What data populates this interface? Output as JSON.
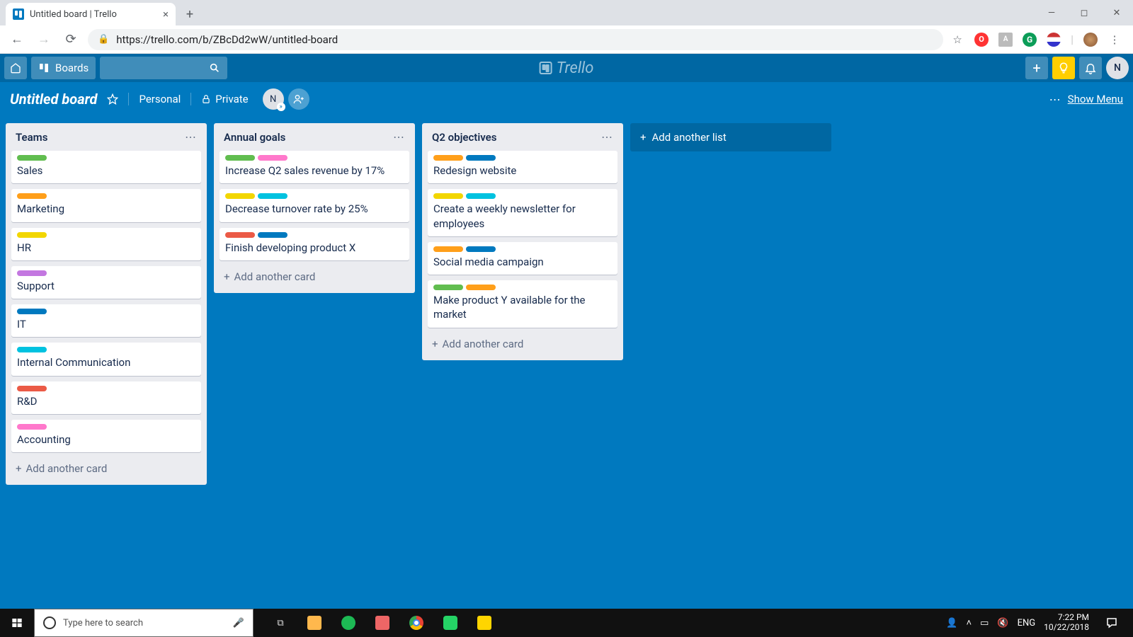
{
  "browser": {
    "tab_title": "Untitled board | Trello",
    "url": "https://trello.com/b/ZBcDd2wW/untitled-board"
  },
  "trello_header": {
    "boards_btn": "Boards",
    "logo_text": "Trello",
    "avatar_initial": "N"
  },
  "board_header": {
    "name": "Untitled board",
    "team": "Personal",
    "visibility": "Private",
    "member_initial": "N",
    "show_menu": "Show Menu"
  },
  "lists": [
    {
      "title": "Teams",
      "cards": [
        {
          "labels": [
            "g"
          ],
          "title": "Sales"
        },
        {
          "labels": [
            "o"
          ],
          "title": "Marketing"
        },
        {
          "labels": [
            "y"
          ],
          "title": "HR"
        },
        {
          "labels": [
            "p"
          ],
          "title": "Support"
        },
        {
          "labels": [
            "b"
          ],
          "title": "IT"
        },
        {
          "labels": [
            "sky"
          ],
          "title": "Internal Communication"
        },
        {
          "labels": [
            "r"
          ],
          "title": "R&D"
        },
        {
          "labels": [
            "pk"
          ],
          "title": "Accounting"
        }
      ]
    },
    {
      "title": "Annual goals",
      "cards": [
        {
          "labels": [
            "g",
            "pk"
          ],
          "title": "Increase Q2 sales revenue by 17%"
        },
        {
          "labels": [
            "y",
            "sky"
          ],
          "title": "Decrease turnover rate by 25%"
        },
        {
          "labels": [
            "r",
            "b"
          ],
          "title": "Finish developing product X"
        }
      ]
    },
    {
      "title": "Q2 objectives",
      "cards": [
        {
          "labels": [
            "o",
            "b"
          ],
          "title": "Redesign website"
        },
        {
          "labels": [
            "y",
            "sky"
          ],
          "title": "Create a weekly newsletter for employees"
        },
        {
          "labels": [
            "o",
            "b"
          ],
          "title": "Social media campaign"
        },
        {
          "labels": [
            "g",
            "o"
          ],
          "title": "Make product Y available for the market"
        }
      ]
    }
  ],
  "add_card_label": "Add another card",
  "add_list_label": "Add another list",
  "taskbar": {
    "search_placeholder": "Type here to search",
    "lang": "ENG",
    "time": "7:22 PM",
    "date": "10/22/2018"
  }
}
